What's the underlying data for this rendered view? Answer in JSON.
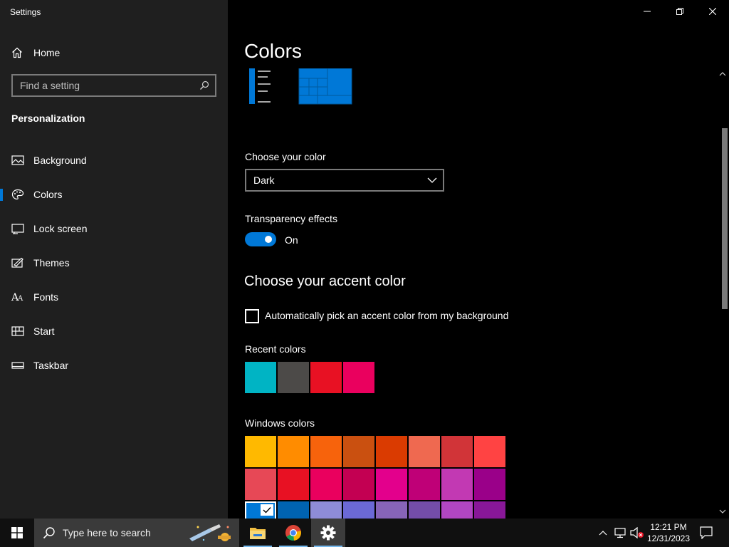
{
  "window": {
    "title": "Settings",
    "minimize_icon": "minimize-icon",
    "restore_icon": "restore-icon",
    "close_icon": "close-icon"
  },
  "sidebar": {
    "home_label": "Home",
    "search_placeholder": "Find a setting",
    "section_label": "Personalization",
    "items": [
      {
        "label": "Background",
        "icon": "picture-icon"
      },
      {
        "label": "Colors",
        "icon": "palette-icon",
        "selected": true
      },
      {
        "label": "Lock screen",
        "icon": "lock-screen-icon"
      },
      {
        "label": "Themes",
        "icon": "brush-icon"
      },
      {
        "label": "Fonts",
        "icon": "font-icon"
      },
      {
        "label": "Start",
        "icon": "start-grid-icon"
      },
      {
        "label": "Taskbar",
        "icon": "taskbar-icon"
      }
    ]
  },
  "main": {
    "title": "Colors",
    "choose_color_label": "Choose your color",
    "choose_color_value": "Dark",
    "transparency_label": "Transparency effects",
    "transparency_state": "On",
    "accent_heading": "Choose your accent color",
    "auto_accent_label": "Automatically pick an accent color from my background",
    "auto_accent_checked": false,
    "recent_colors_label": "Recent colors",
    "recent_colors": [
      "#00b4c4",
      "#4c4a48",
      "#e81123",
      "#ea005e"
    ],
    "windows_colors_label": "Windows colors",
    "windows_colors": [
      [
        "#ffb900",
        "#ff8c00",
        "#f7630c",
        "#ca5010",
        "#da3b01",
        "#ef6950",
        "#d13438",
        "#ff4343"
      ],
      [
        "#e74856",
        "#e81123",
        "#ea005e",
        "#c30052",
        "#e3008c",
        "#bf0077",
        "#c239b3",
        "#9a0089"
      ],
      [
        "#0078d7",
        "#0063b1",
        "#8e8cd8",
        "#6b69d6",
        "#8764b8",
        "#744da9",
        "#b146c2",
        "#881798"
      ]
    ],
    "selected_color": "#0078d7",
    "accent": "#0078d7"
  },
  "taskbar": {
    "search_placeholder": "Type here to search",
    "apps": [
      "file-explorer-icon",
      "chrome-icon",
      "settings-gear-icon"
    ],
    "clock_time": "12:21 PM",
    "clock_date": "12/31/2023"
  }
}
